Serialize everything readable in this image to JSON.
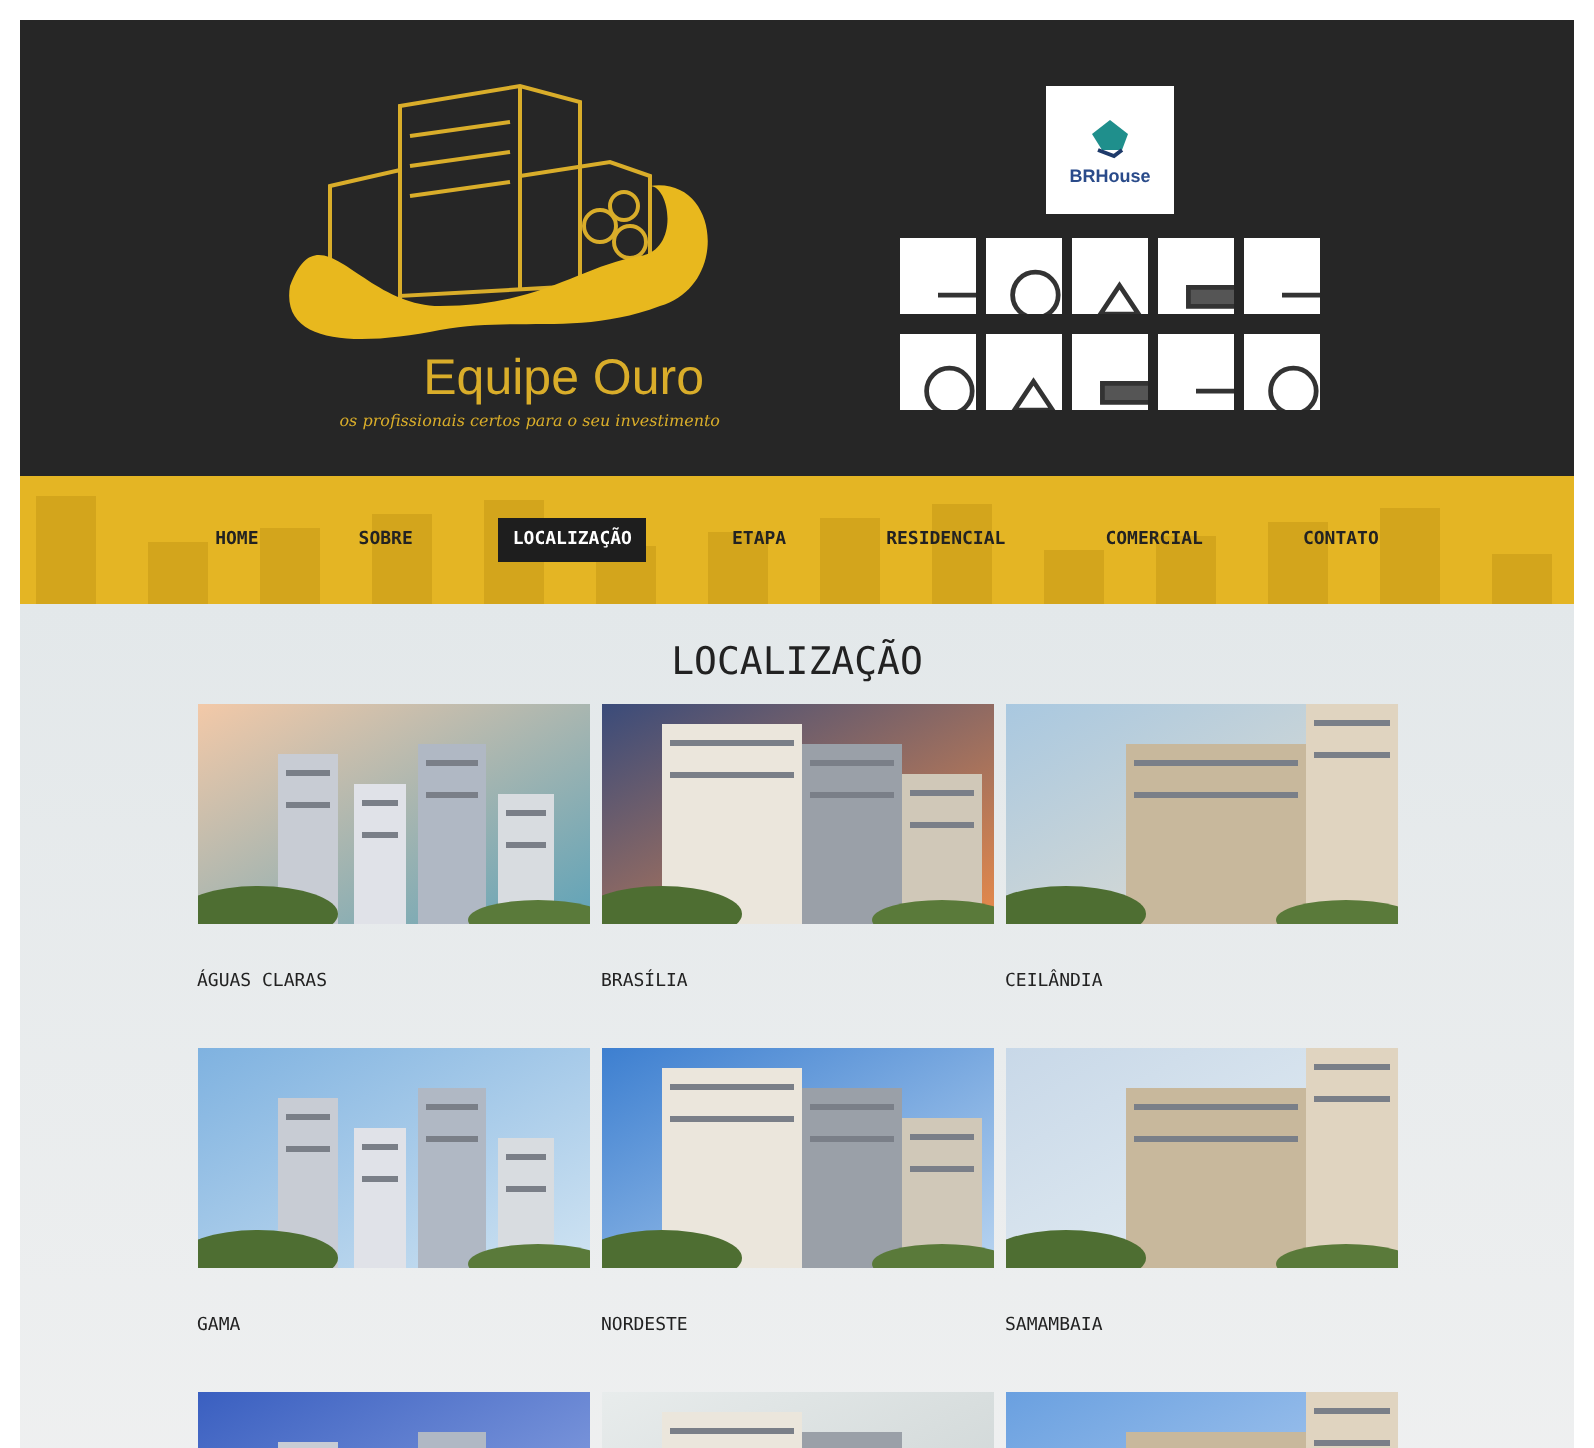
{
  "brand": {
    "name": "Equipe Ouro",
    "tagline": "os profissionais certos para o seu investimento"
  },
  "featured_partner": {
    "name": "BRHouse"
  },
  "partner_logos": [
    {
      "kind": "picture"
    },
    {
      "kind": "picture"
    },
    {
      "kind": "picture"
    },
    {
      "kind": "picture"
    },
    {
      "kind": "picture"
    },
    {
      "kind": "picture"
    },
    {
      "kind": "picture"
    },
    {
      "kind": "picture"
    },
    {
      "kind": "picture"
    },
    {
      "kind": "picture"
    }
  ],
  "nav": [
    {
      "label": "HOME",
      "selected": false
    },
    {
      "label": "SOBRE",
      "selected": false
    },
    {
      "label": "LOCALIZAÇÃO",
      "selected": true
    },
    {
      "label": "ETAPA",
      "selected": false
    },
    {
      "label": "RESIDENCIAL",
      "selected": false
    },
    {
      "label": "COMERCIAL",
      "selected": false
    },
    {
      "label": "CONTATO",
      "selected": false
    }
  ],
  "heading": "LOCALIZAÇÃO",
  "locations": [
    {
      "kind": "picture",
      "name": "ÁGUAS CLARAS"
    },
    {
      "kind": "picture",
      "name": "BRASÍLIA"
    },
    {
      "kind": "picture",
      "name": "CEILÂNDIA"
    },
    {
      "kind": "picture",
      "name": "GAMA"
    },
    {
      "kind": "picture",
      "name": "NORDESTE"
    },
    {
      "kind": "picture",
      "name": "SAMAMBAIA"
    },
    {
      "kind": "picture"
    },
    {
      "kind": "picture"
    },
    {
      "kind": "picture"
    }
  ]
}
